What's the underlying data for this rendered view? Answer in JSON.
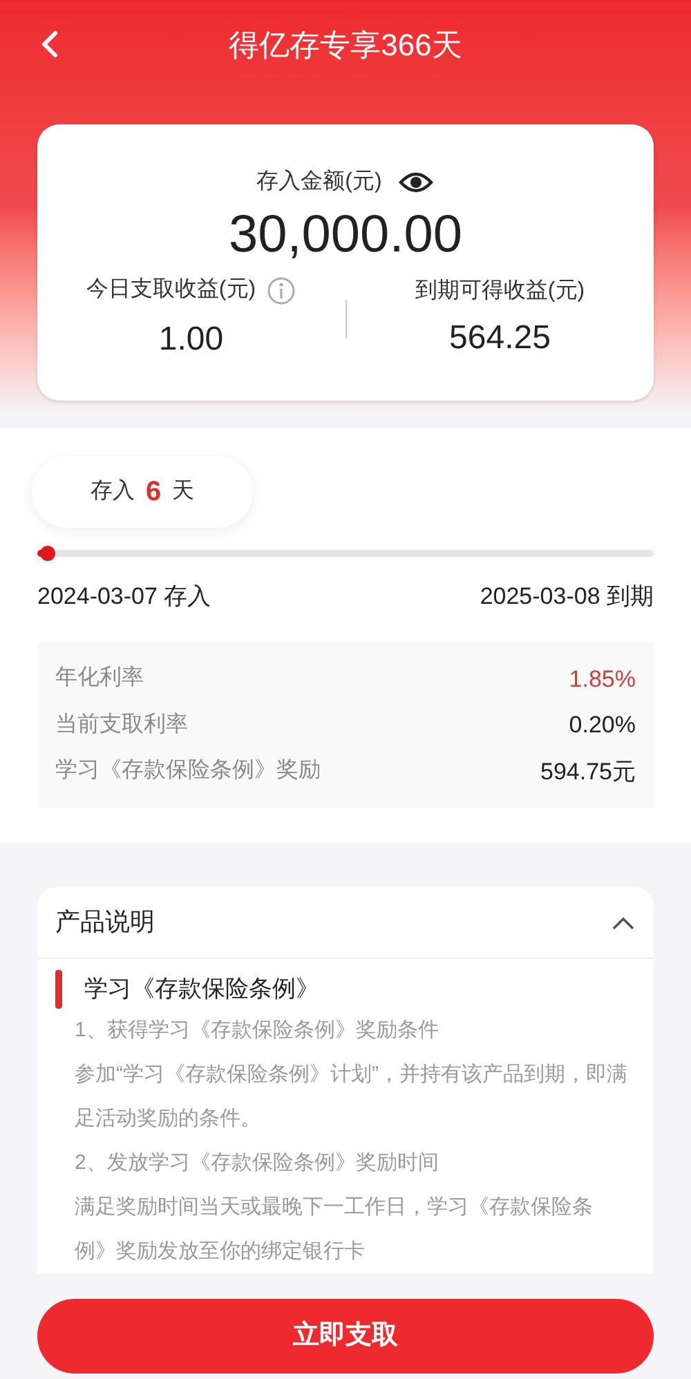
{
  "header": {
    "title": "得亿存专享366天"
  },
  "summary": {
    "amount_label": "存入金额(元)",
    "amount": "30,000.00",
    "left": {
      "label": "今日支取收益(元)",
      "value": "1.00"
    },
    "right": {
      "label": "到期可得收益(元)",
      "value": "564.25"
    }
  },
  "term": {
    "prefix": "存入",
    "days": "6",
    "suffix": "天",
    "level": 0.016,
    "start": "2024-03-07 存入",
    "end": "2025-03-08 到期"
  },
  "rates": [
    {
      "label": "年化利率",
      "value": "1.85%",
      "highlight": true
    },
    {
      "label": "当前支取利率",
      "value": "0.20%",
      "highlight": false
    },
    {
      "label": "学习《存款保险条例》奖励",
      "value": "594.75元",
      "highlight": false
    }
  ],
  "product": {
    "title": "产品说明",
    "expanded": true,
    "heading": "学习《存款保险条例》",
    "paragraphs": [
      "1、获得学习《存款保险条例》奖励条件",
      "参加“学习《存款保险条例》计划”，并持有该产品到期，即满足活动奖励的条件。",
      "2、发放学习《存款保险条例》奖励时间",
      "满足奖励时间当天或最晚下一工作日，学习《存款保险条例》奖励发放至你的绑定银行卡"
    ]
  },
  "action": {
    "label": "立即支取"
  }
}
